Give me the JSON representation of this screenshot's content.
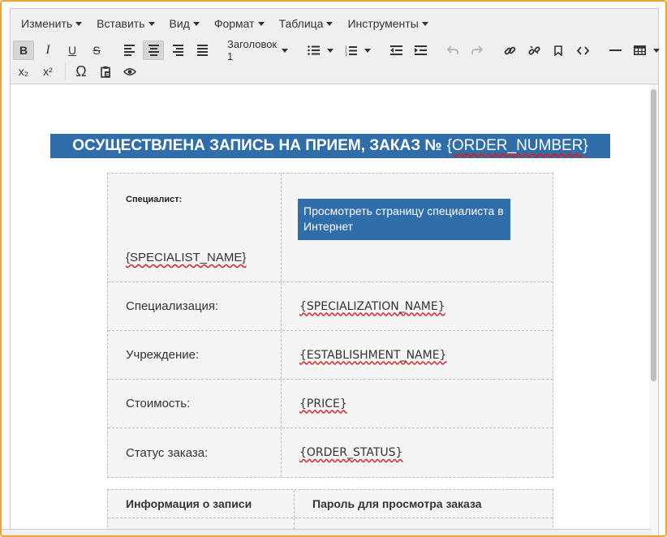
{
  "menubar": {
    "items": [
      "Изменить",
      "Вставить",
      "Вид",
      "Формат",
      "Таблица",
      "Инструменты"
    ]
  },
  "toolbar": {
    "bold": "B",
    "italic": "I",
    "underline": "U",
    "strikethrough": "S",
    "block_format": "Заголовок 1",
    "subscript": "x₂",
    "superscript": "x²",
    "special_char": "Ω",
    "icons": [
      "bold-icon",
      "italic-icon",
      "underline-icon",
      "strikethrough-icon",
      "align-left-icon",
      "align-center-icon",
      "align-right-icon",
      "align-justify-icon",
      "bullet-list-icon",
      "numbered-list-icon",
      "outdent-icon",
      "indent-icon",
      "undo-icon",
      "redo-icon",
      "link-icon",
      "unlink-icon",
      "bookmark-icon",
      "code-icon",
      "horizontal-rule-icon",
      "table-icon",
      "subscript-icon",
      "superscript-icon",
      "omega-icon",
      "paste-icon",
      "preview-eye-icon"
    ]
  },
  "document": {
    "heading_text": "ОСУЩЕСТВЛЕНА ЗАПИСЬ НА ПРИЕМ, ЗАКАЗ №",
    "heading_placeholder": "{ORDER_NUMBER}",
    "specialist_label": "Специалист:",
    "specialist_value": "{SPECIALIST_NAME}",
    "profile_button": "Просмотреть страницу специалиста в Интернет",
    "rows": [
      {
        "label": "Специализация:",
        "value": "{SPECIALIZATION_NAME}"
      },
      {
        "label": "Учреждение:",
        "value": "{ESTABLISHMENT_NAME}"
      },
      {
        "label": "Стоимость:",
        "value": "{PRICE}"
      },
      {
        "label": "Статус заказа:",
        "value": "{ORDER_STATUS}"
      }
    ],
    "info_table": {
      "col1": "Информация о записи",
      "col2": "Пароль для просмотра заказа"
    }
  },
  "colors": {
    "accent": "#2f6eaa",
    "frame_border": "#f3a230",
    "toolbar_bg": "#f0f0f0"
  }
}
